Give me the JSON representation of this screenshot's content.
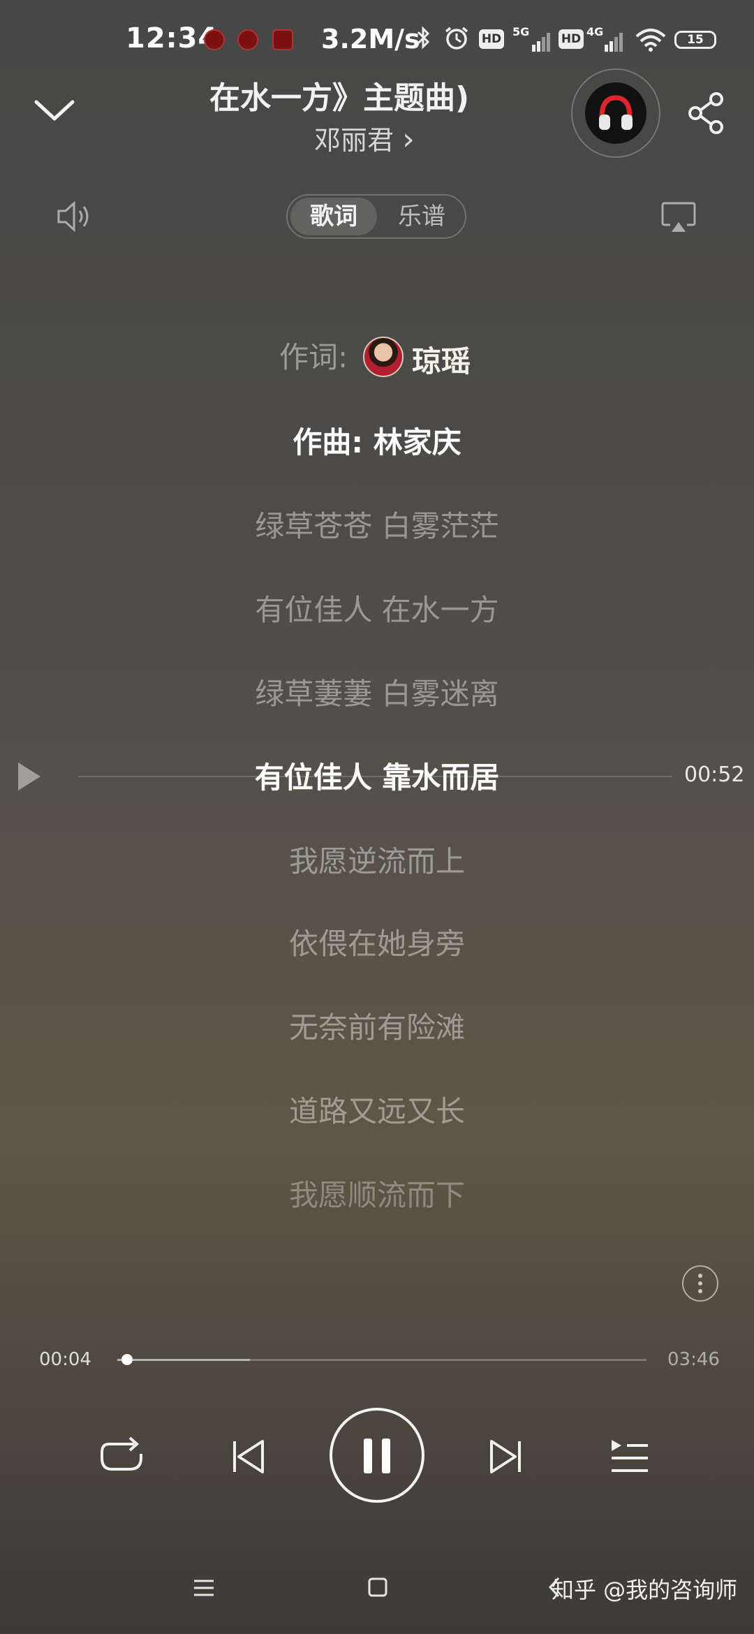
{
  "status_bar": {
    "time": "12:34",
    "net_speed": "3.2M/s",
    "hd_label": "HD",
    "net_5g": "5G",
    "net_4g": "4G",
    "battery": "15"
  },
  "header": {
    "title": "在水一方》主题曲)",
    "artist": "邓丽君",
    "artist_chevron": "›"
  },
  "tabs": {
    "lyrics": "歌词",
    "score": "乐谱"
  },
  "lyrics": {
    "lyricist_label": "作词:",
    "lyricist_name": "琼瑶",
    "composer": "作曲: 林家庆",
    "lines": [
      "绿草苍苍 白雾茫茫",
      "有位佳人 在水一方",
      "绿草萋萋 白雾迷离",
      "有位佳人 靠水而居",
      "我愿逆流而上",
      "依偎在她身旁",
      "无奈前有险滩",
      "道路又远又长",
      "我愿顺流而下"
    ],
    "seek_time": "00:52"
  },
  "player": {
    "elapsed": "00:04",
    "total": "03:46",
    "progress_fraction": 0.018,
    "buffer_fraction": 0.25
  },
  "watermark": "知乎 @我的咨询师",
  "colors": {
    "text_active": "#ffffff",
    "text_dim": "rgba(255,255,255,0.42)"
  }
}
